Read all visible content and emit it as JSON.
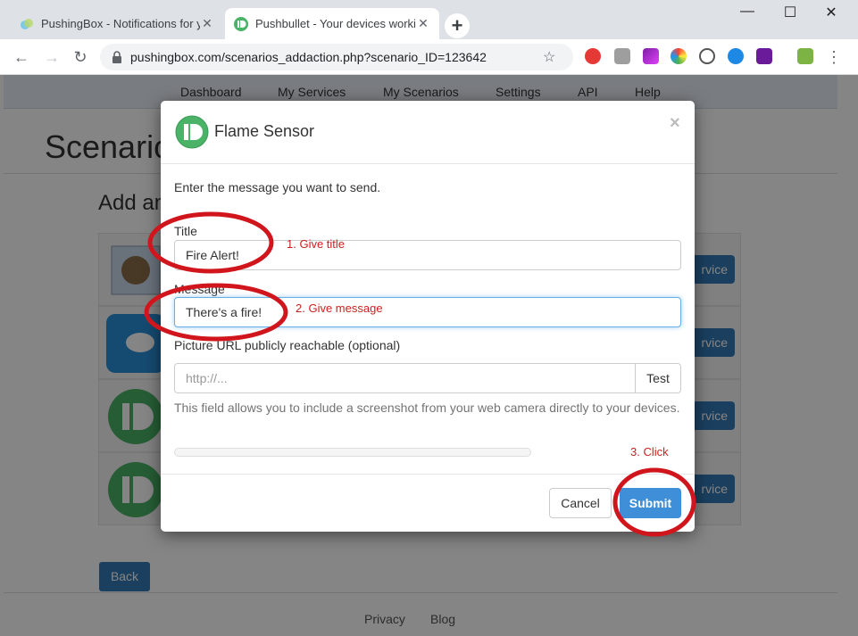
{
  "browser": {
    "tabs": [
      {
        "title": "PushingBox - Notifications for your",
        "close": "✕"
      },
      {
        "title": "Pushbullet - Your devices working",
        "close": "✕"
      }
    ],
    "new_tab": "+",
    "window_controls": {
      "minimize": "—",
      "maximize": "☐",
      "close": "✕"
    },
    "url": "pushingbox.com/scenarios_addaction.php?scenario_ID=123642",
    "back": "←",
    "forward": "→",
    "reload": "↻",
    "star": "☆",
    "menu": "⋮"
  },
  "site": {
    "nav": [
      "Dashboard",
      "My Services",
      "My Scenarios",
      "Settings",
      "API",
      "Help"
    ],
    "heading": "Scenario",
    "subheading": "Add an",
    "service_button_label": "rvice",
    "back_label": "Back",
    "footer": [
      "Privacy",
      "Blog"
    ]
  },
  "modal": {
    "title": "Flame Sensor",
    "close": "×",
    "intro": "Enter the message you want to send.",
    "title_label": "Title",
    "title_value": "Fire Alert!",
    "message_label": "Message",
    "message_value": "There's a fire!",
    "picture_label": "Picture URL publicly reachable (optional)",
    "picture_placeholder": "http://...",
    "test_label": "Test",
    "help_text": "This field allows you to include a screenshot from your web camera directly to your devices.",
    "progress": 0,
    "cancel_label": "Cancel",
    "submit_label": "Submit"
  },
  "annotations": {
    "step1": "1. Give title",
    "step2": "2. Give message",
    "step3": "3. Click",
    "color": "#d0161c"
  },
  "colors": {
    "primary": "#337ab7",
    "submit": "#3f8fd8",
    "pushbullet_green": "#4ab367"
  }
}
